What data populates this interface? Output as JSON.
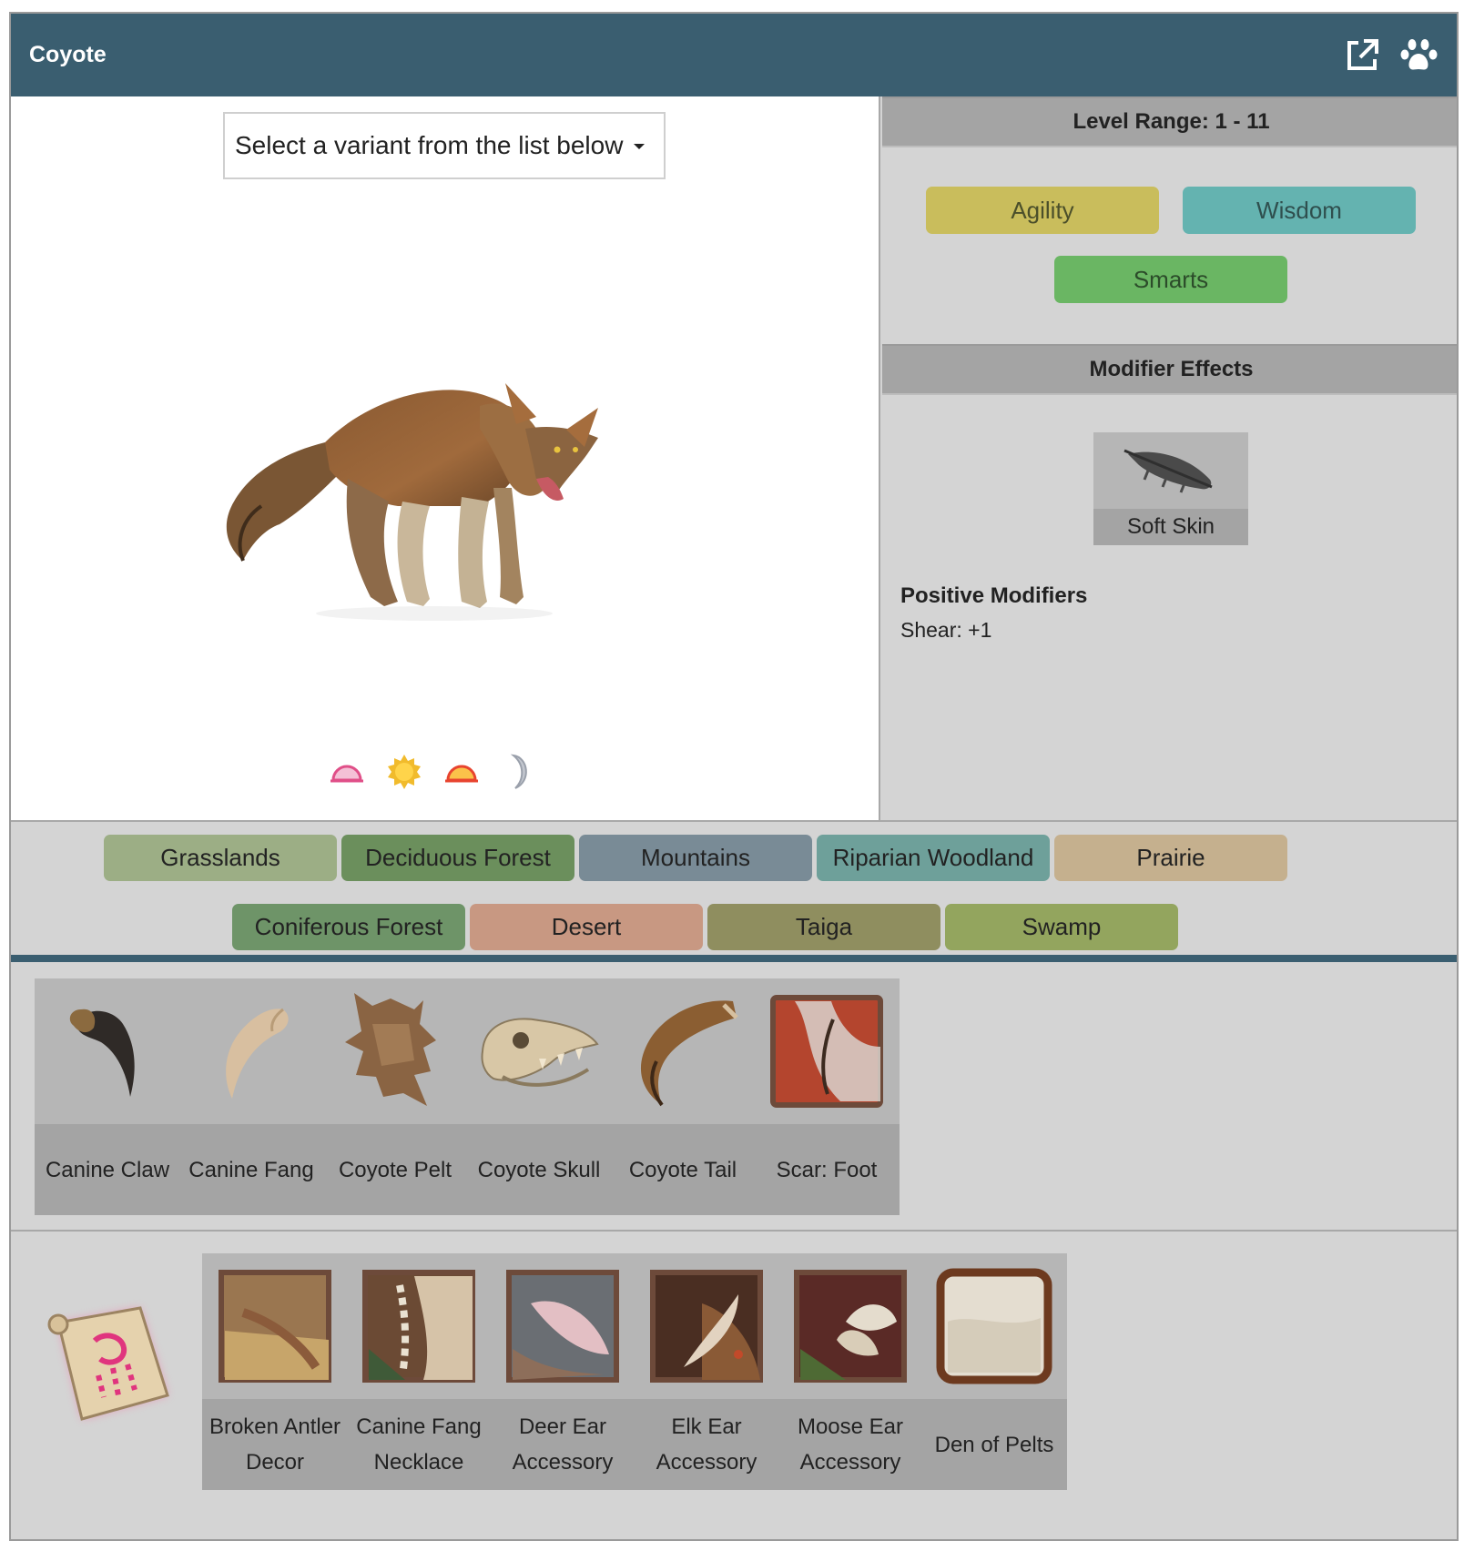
{
  "header": {
    "title": "Coyote",
    "icons": [
      "external-link-icon",
      "paw-icon"
    ]
  },
  "variant": {
    "label": "Select a variant from the list below"
  },
  "time_icons": [
    "dawn-icon",
    "sun-icon",
    "dusk-icon",
    "moon-icon"
  ],
  "stats": {
    "level_range": "Level Range: 1 - 11",
    "items": [
      {
        "label": "Agility",
        "color": "#c9bd5c"
      },
      {
        "label": "Wisdom",
        "color": "#64b3b0"
      },
      {
        "label": "Smarts",
        "color": "#6ab663"
      }
    ]
  },
  "modifiers": {
    "title": "Modifier Effects",
    "effect": {
      "label": "Soft Skin",
      "icon": "feather-icon"
    },
    "positive_title": "Positive Modifiers",
    "positive_values": [
      "Shear: +1"
    ]
  },
  "habitats": [
    {
      "label": "Grasslands",
      "color": "#9cae85"
    },
    {
      "label": "Deciduous Forest",
      "color": "#6b8f5c"
    },
    {
      "label": "Mountains",
      "color": "#798b96"
    },
    {
      "label": "Riparian Woodland",
      "color": "#6ea09a"
    },
    {
      "label": "Prairie",
      "color": "#c5b08e"
    },
    {
      "label": "Coniferous Forest",
      "color": "#6e9468"
    },
    {
      "label": "Desert",
      "color": "#c89882"
    },
    {
      "label": "Taiga",
      "color": "#8f8e5f"
    },
    {
      "label": "Swamp",
      "color": "#93a55e"
    }
  ],
  "drops": [
    {
      "label": "Canine Claw",
      "icon": "claw-icon"
    },
    {
      "label": "Canine Fang",
      "icon": "fang-icon"
    },
    {
      "label": "Coyote Pelt",
      "icon": "pelt-icon"
    },
    {
      "label": "Coyote Skull",
      "icon": "skull-icon"
    },
    {
      "label": "Coyote Tail",
      "icon": "tail-icon"
    },
    {
      "label": "Scar: Foot",
      "icon": "scar-icon"
    }
  ],
  "crafts": [
    {
      "label": "Broken Antler Decor",
      "icon": "antler-decor-icon"
    },
    {
      "label": "Canine Fang Necklace",
      "icon": "fang-necklace-icon"
    },
    {
      "label": "Deer Ear Accessory",
      "icon": "deer-ear-icon"
    },
    {
      "label": "Elk Ear Accessory",
      "icon": "elk-ear-icon"
    },
    {
      "label": "Moose Ear Accessory",
      "icon": "moose-ear-icon"
    },
    {
      "label": "Den of Pelts",
      "icon": "den-icon"
    }
  ]
}
